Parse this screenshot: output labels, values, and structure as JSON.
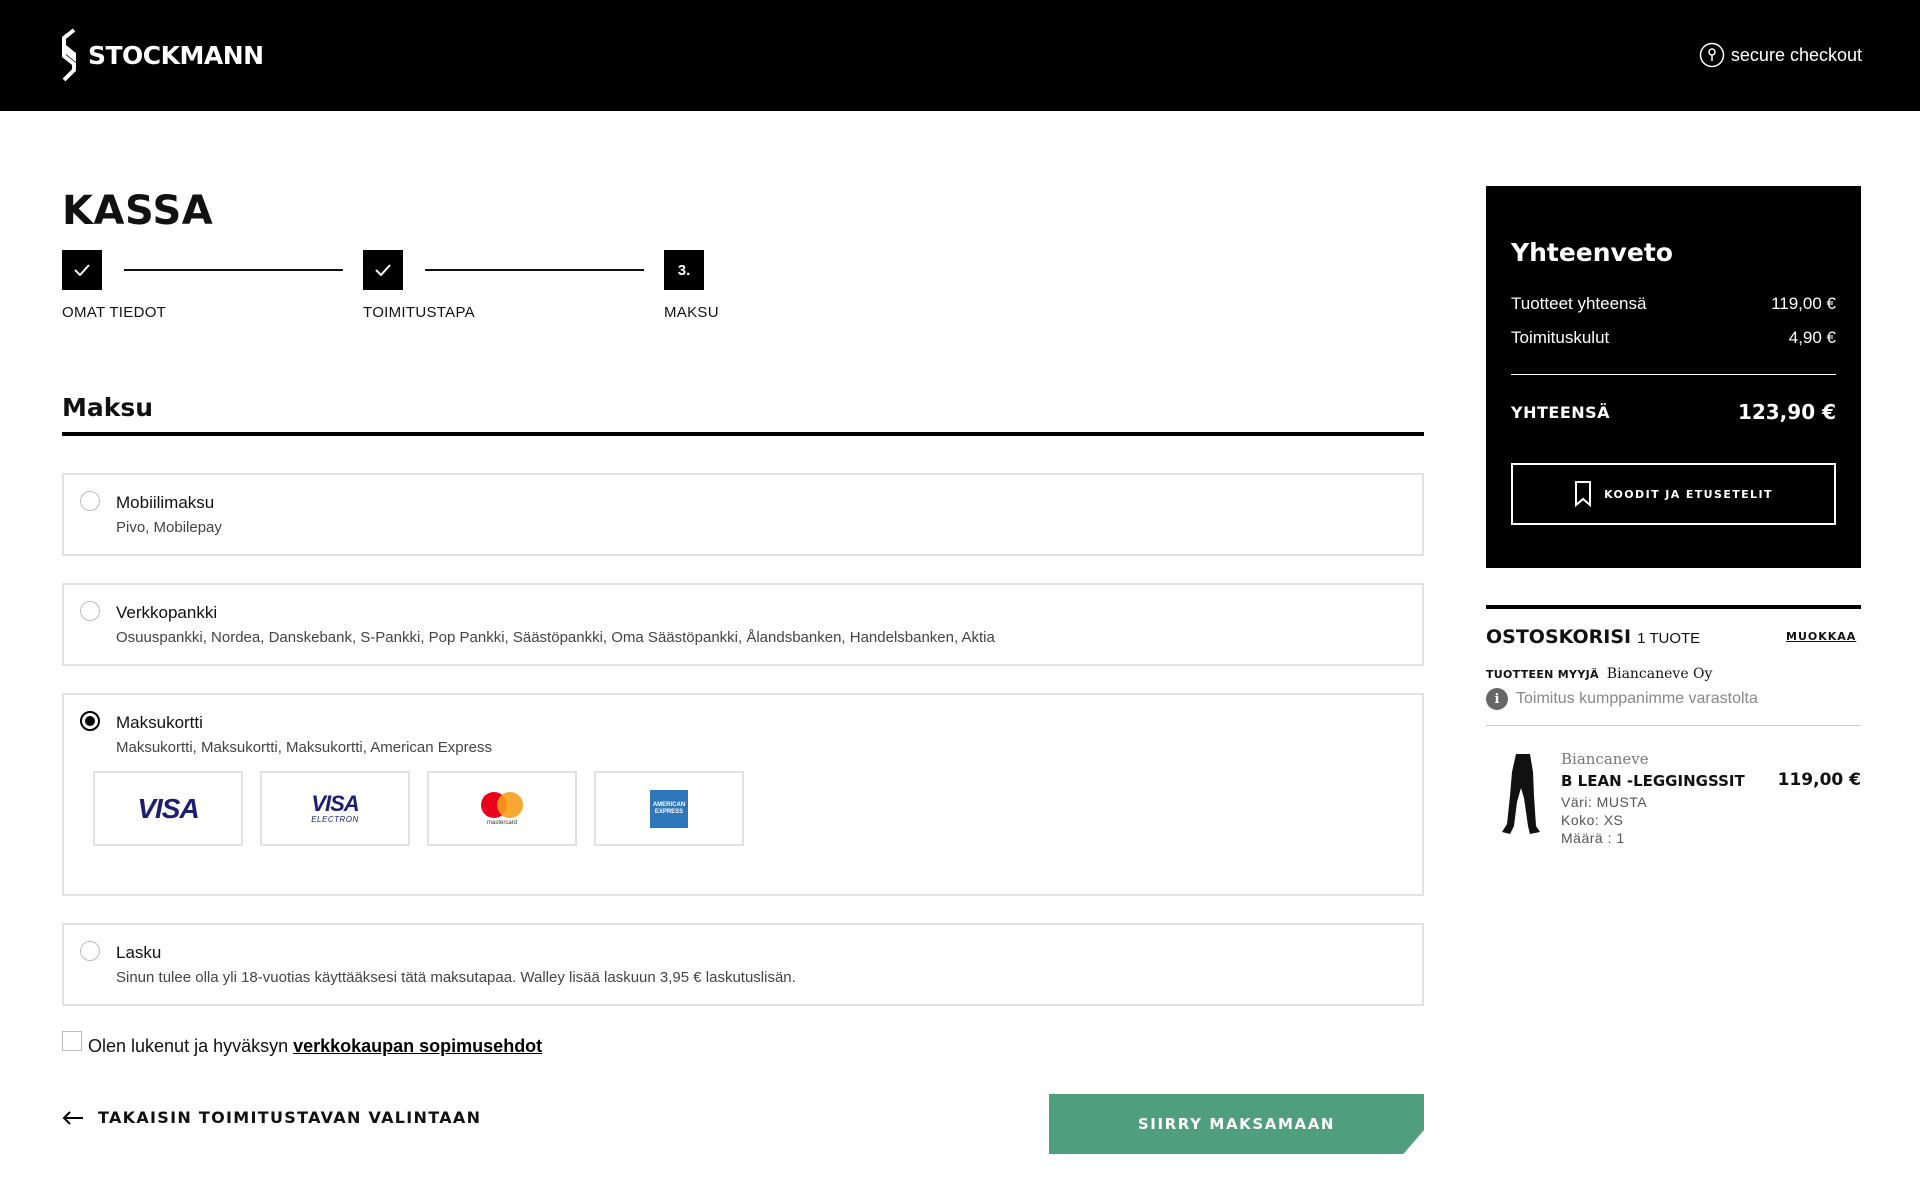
{
  "header": {
    "brand": "STOCKMANN",
    "secure_label": "secure checkout"
  },
  "checkout": {
    "title": "KASSA",
    "steps": [
      {
        "label": "OMAT TIEDOT",
        "state": "done",
        "marker": ""
      },
      {
        "label": "TOIMITUSTAPA",
        "state": "done",
        "marker": ""
      },
      {
        "label": "MAKSU",
        "state": "current",
        "marker": "3."
      }
    ]
  },
  "payment": {
    "section_title": "Maksu",
    "options": [
      {
        "title": "Mobiilimaksu",
        "subtitle": "Pivo, Mobilepay",
        "selected": false
      },
      {
        "title": "Verkkopankki",
        "subtitle": "Osuuspankki, Nordea, Danskebank, S-Pankki, Pop Pankki, Säästöpankki, Oma Säästöpankki, Ålandsbanken, Handelsbanken, Aktia",
        "selected": false
      },
      {
        "title": "Maksukortti",
        "subtitle": "Maksukortti, Maksukortti, Maksukortti, American Express",
        "selected": true
      },
      {
        "title": "Lasku",
        "subtitle": "Sinun tulee olla yli 18-vuotias käyttääksesi tätä maksutapaa. Walley lisää laskuun 3,95 € laskutuslisän.",
        "selected": false
      }
    ],
    "cards": {
      "visa": "VISA",
      "visa_electron_main": "VISA",
      "visa_electron_sub": "ELECTRON",
      "mastercard": "mastercard",
      "amex": "AMERICAN EXPRESS"
    }
  },
  "terms": {
    "text": "Olen lukenut ja hyväksyn",
    "link": "verkkokaupan sopimusehdot",
    "checked": false
  },
  "actions": {
    "back": "TAKAISIN TOIMITUSTAVAN VALINTAAN",
    "pay": "SIIRRY MAKSAMAAN"
  },
  "summary": {
    "title": "Yhteenveto",
    "rows": [
      {
        "label": "Tuotteet yhteensä",
        "value": "119,00 €"
      },
      {
        "label": "Toimituskulut",
        "value": "4,90 €"
      }
    ],
    "total_label": "YHTEENSÄ",
    "total_value": "123,90 €",
    "codes_button": "KOODIT JA ETUSETELIT"
  },
  "cart": {
    "title": "OSTOSKORISI",
    "count": "1 TUOTE",
    "edit": "MUOKKAA",
    "seller_label": "TUOTTEEN MYYJÄ",
    "seller_name": "Biancaneve Oy",
    "delivery_note": "Toimitus kumppanimme varastolta",
    "items": [
      {
        "brand": "Biancaneve",
        "name": "B LEAN -LEGGINGSSIT",
        "price": "119,00 €",
        "color": "Väri: MUSTA",
        "size": "Koko: XS",
        "qty": "Määrä : 1"
      }
    ]
  },
  "colors": {
    "primary_button": "#4f9e7d",
    "header_bg": "#000000"
  }
}
